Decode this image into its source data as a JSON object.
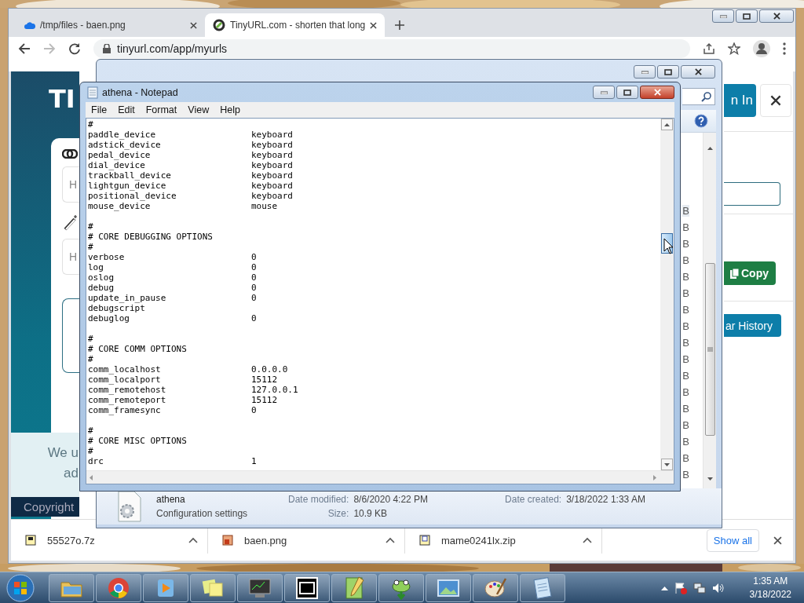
{
  "browser": {
    "tabs": [
      {
        "title": "/tmp/files - baen.png",
        "selected": false
      },
      {
        "title": "TinyURL.com - shorten that long",
        "selected": true
      }
    ],
    "address": "tinyurl.com/app/myurls",
    "page": {
      "logo": "TI",
      "sign_in": "n In",
      "inputs": [
        {
          "placeholder": "H"
        },
        {
          "placeholder": "H"
        }
      ],
      "copy_button": "Copy",
      "history_button": "ar History",
      "cookie_notice": [
        "We u",
        "ad"
      ],
      "footer": "Copyright"
    },
    "downloads": [
      {
        "name": "55527o.7z",
        "kind": "sevenzip"
      },
      {
        "name": "baen.png"
      },
      {
        "name": "mame0241lx.zip",
        "kind": "zip"
      }
    ],
    "show_all": "Show all"
  },
  "explorer": {
    "size_column": [
      {
        "text": "B",
        "selected": true
      },
      {
        "text": "B",
        "selected": false
      },
      {
        "text": "B",
        "selected": false
      },
      {
        "text": "B",
        "selected": false
      },
      {
        "text": "B",
        "selected": false
      },
      {
        "text": "B",
        "selected": false
      },
      {
        "text": "B",
        "selected": false
      },
      {
        "text": "B",
        "selected": false
      },
      {
        "text": "B",
        "selected": false
      },
      {
        "text": "B",
        "selected": false
      },
      {
        "text": "B",
        "selected": false
      },
      {
        "text": "B",
        "selected": false
      },
      {
        "text": "B",
        "selected": false
      },
      {
        "text": "B",
        "selected": false
      },
      {
        "text": "B",
        "selected": false
      },
      {
        "text": "B",
        "selected": false
      },
      {
        "text": "B",
        "selected": false
      }
    ],
    "details": {
      "name": "athena",
      "type": "Configuration settings",
      "date_modified_label": "Date modified:",
      "date_modified": "8/6/2020 4:22 PM",
      "date_created_label": "Date created:",
      "date_created": "3/18/2022 1:33 AM",
      "size_label": "Size:",
      "size": "10.9 KB"
    }
  },
  "notepad": {
    "title": "athena - Notepad",
    "menu": [
      "File",
      "Edit",
      "Format",
      "View",
      "Help"
    ],
    "lines": [
      {
        "kind": "comment",
        "text": "#"
      },
      {
        "kind": "setting",
        "key": "paddle_device",
        "value": "keyboard"
      },
      {
        "kind": "setting",
        "key": "adstick_device",
        "value": "keyboard"
      },
      {
        "kind": "setting",
        "key": "pedal_device",
        "value": "keyboard"
      },
      {
        "kind": "setting",
        "key": "dial_device",
        "value": "keyboard"
      },
      {
        "kind": "setting",
        "key": "trackball_device",
        "value": "keyboard"
      },
      {
        "kind": "setting",
        "key": "lightgun_device",
        "value": "keyboard"
      },
      {
        "kind": "setting",
        "key": "positional_device",
        "value": "keyboard"
      },
      {
        "kind": "setting",
        "key": "mouse_device",
        "value": "mouse"
      },
      {
        "kind": "blank"
      },
      {
        "kind": "comment",
        "text": "#"
      },
      {
        "kind": "comment",
        "text": "# CORE DEBUGGING OPTIONS"
      },
      {
        "kind": "comment",
        "text": "#"
      },
      {
        "kind": "setting",
        "key": "verbose",
        "value": "0"
      },
      {
        "kind": "setting",
        "key": "log",
        "value": "0"
      },
      {
        "kind": "setting",
        "key": "oslog",
        "value": "0"
      },
      {
        "kind": "setting",
        "key": "debug",
        "value": "0"
      },
      {
        "kind": "setting",
        "key": "update_in_pause",
        "value": "0"
      },
      {
        "kind": "setting",
        "key": "debugscript"
      },
      {
        "kind": "setting",
        "key": "debuglog",
        "value": "0"
      },
      {
        "kind": "blank"
      },
      {
        "kind": "comment",
        "text": "#"
      },
      {
        "kind": "comment",
        "text": "# CORE COMM OPTIONS"
      },
      {
        "kind": "comment",
        "text": "#"
      },
      {
        "kind": "setting",
        "key": "comm_localhost",
        "value": "0.0.0.0"
      },
      {
        "kind": "setting",
        "key": "comm_localport",
        "value": "15112"
      },
      {
        "kind": "setting",
        "key": "comm_remotehost",
        "value": "127.0.0.1"
      },
      {
        "kind": "setting",
        "key": "comm_remoteport",
        "value": "15112"
      },
      {
        "kind": "setting",
        "key": "comm_framesync",
        "value": "0"
      },
      {
        "kind": "blank"
      },
      {
        "kind": "comment",
        "text": "#"
      },
      {
        "kind": "comment",
        "text": "# CORE MISC OPTIONS"
      },
      {
        "kind": "comment",
        "text": "#"
      },
      {
        "kind": "setting",
        "key": "drc",
        "value": "1"
      }
    ]
  },
  "taskbar": {
    "clock": {
      "time": "1:35 AM",
      "date": "3/18/2022"
    }
  }
}
